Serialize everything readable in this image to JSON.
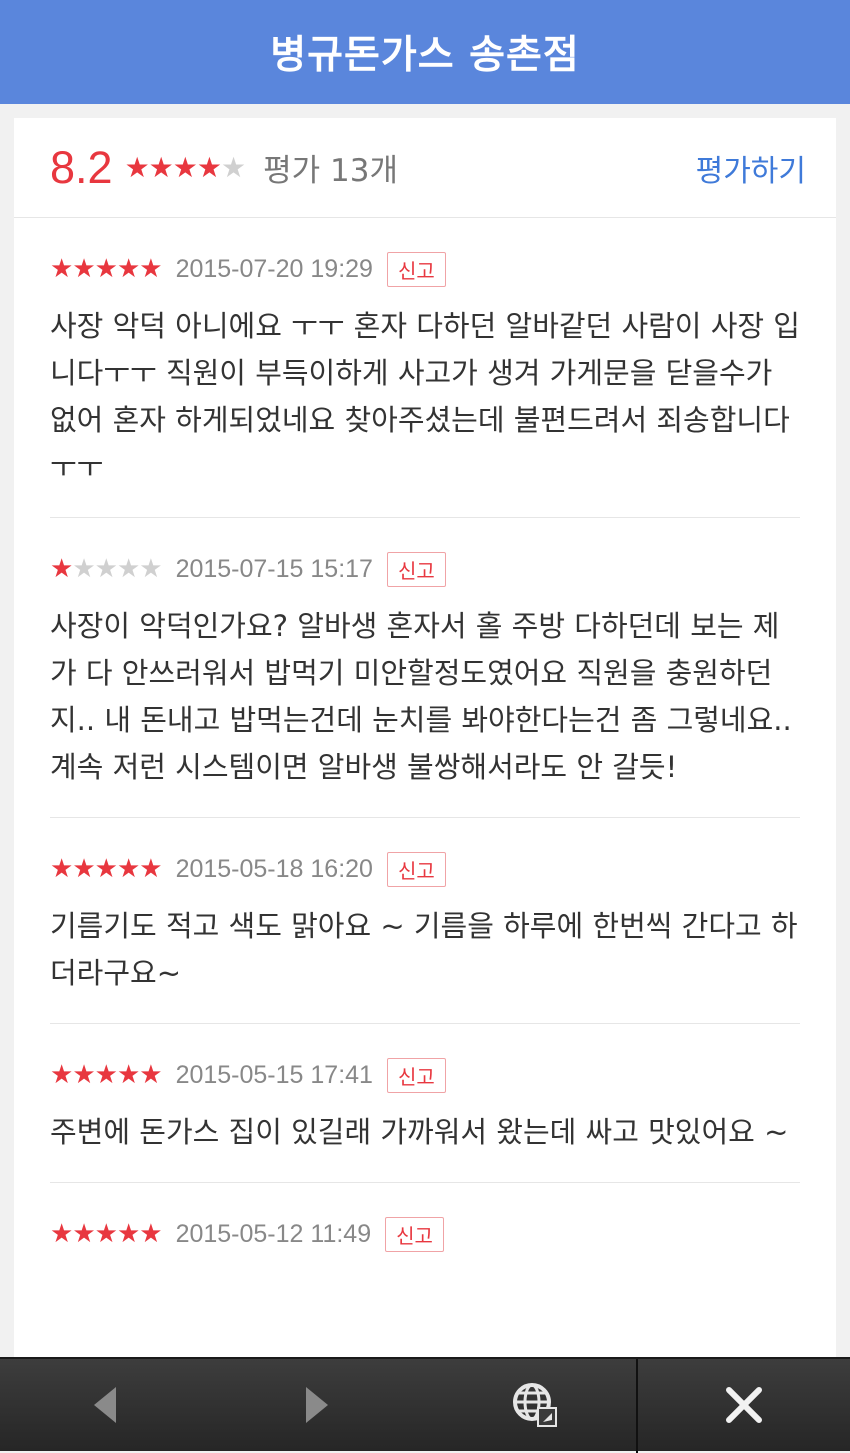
{
  "header": {
    "title": "병규돈가스 송촌점"
  },
  "summary": {
    "score": "8.2",
    "rating_stars": 4,
    "count_label": "평가 13개",
    "rate_link": "평가하기"
  },
  "colors": {
    "header": "#5a86dc",
    "accent_red": "#e8373f",
    "link_blue": "#3f7ad9"
  },
  "reviews": [
    {
      "stars": 5,
      "date": "2015-07-20 19:29",
      "report": "신고",
      "text": "사장 악덕 아니에요 ㅜㅜ 혼자 다하던 알바같던 사람이 사장 입니다ㅜㅜ 직원이 부득이하게 사고가 생겨 가게문을 닫을수가 없어 혼자 하게되었네요 찾아주셨는데 불편드려서 죄송합니다 ㅜㅜ"
    },
    {
      "stars": 1,
      "date": "2015-07-15 15:17",
      "report": "신고",
      "text": "사장이 악덕인가요? 알바생 혼자서 홀 주방 다하던데 보는 제가 다 안쓰러워서 밥먹기 미안할정도였어요 직원을 충원하던지.. 내 돈내고 밥먹는건데 눈치를 봐야한다는건 좀 그렇네요.. 계속 저런 시스템이면 알바생 불쌍해서라도 안 갈듯!"
    },
    {
      "stars": 5,
      "date": "2015-05-18 16:20",
      "report": "신고",
      "text": "기름기도 적고 색도 맑아요 ~ 기름을 하루에 한번씩 간다고 하더라구요~"
    },
    {
      "stars": 5,
      "date": "2015-05-15 17:41",
      "report": "신고",
      "text": "주변에 돈가스 집이 있길래 가까워서 왔는데 싸고 맛있어요 ~"
    },
    {
      "stars": 5,
      "date": "2015-05-12 11:49",
      "report": "신고",
      "text": ""
    }
  ],
  "bottom_bar": {
    "icons": [
      "back-arrow-icon",
      "forward-arrow-icon",
      "web-browser-icon",
      "close-icon"
    ]
  }
}
